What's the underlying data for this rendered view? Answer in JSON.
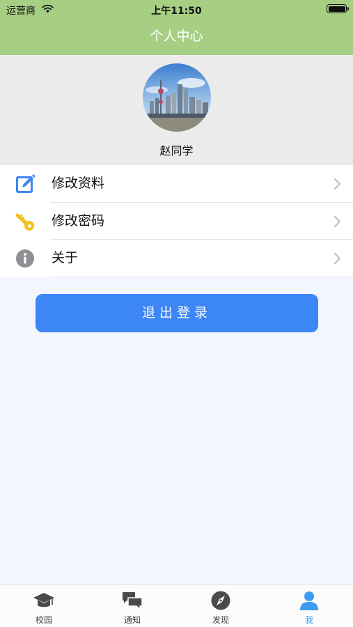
{
  "status_bar": {
    "carrier": "运营商",
    "time": "上午11:50"
  },
  "nav": {
    "title": "个人中心"
  },
  "profile": {
    "username": "赵同学"
  },
  "menu": {
    "items": [
      {
        "label": "修改资料",
        "icon": "edit-icon"
      },
      {
        "label": "修改密码",
        "icon": "key-icon"
      },
      {
        "label": "关于",
        "icon": "info-icon"
      }
    ]
  },
  "logout": {
    "label": "退出登录"
  },
  "tabs": [
    {
      "label": "校园",
      "icon": "graduation-cap-icon"
    },
    {
      "label": "通知",
      "icon": "chat-bubbles-icon"
    },
    {
      "label": "发现",
      "icon": "compass-icon"
    },
    {
      "label": "我",
      "icon": "user-icon",
      "active": true
    }
  ],
  "colors": {
    "nav": "#a7cf84",
    "accent": "#3d86f6",
    "tab_active": "#3d9cf0"
  }
}
